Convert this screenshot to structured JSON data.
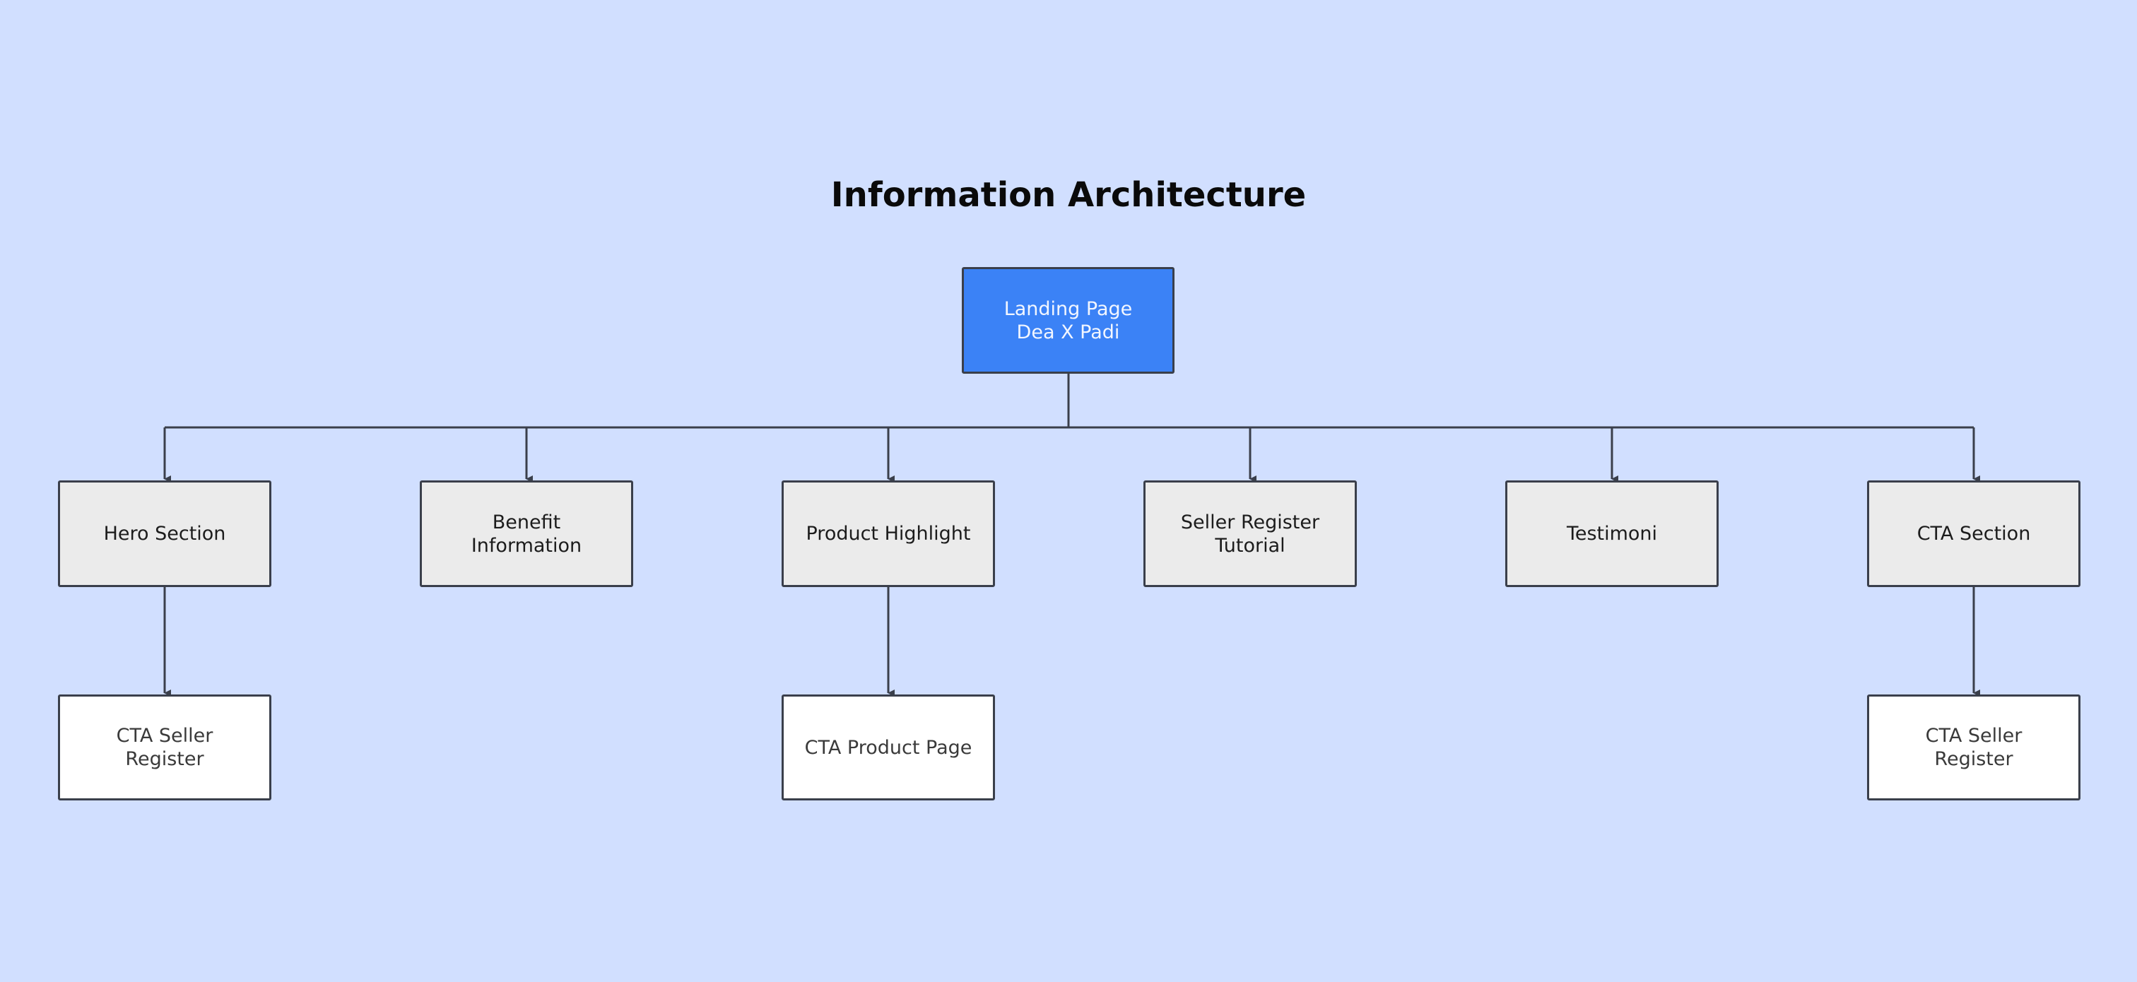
{
  "title": "Information Architecture",
  "colors": {
    "background": "#d1dfff",
    "root_fill": "#3b82f6",
    "section_fill": "#ebebeb",
    "child_fill": "#ffffff",
    "stroke": "#3a3f4b"
  },
  "root": {
    "label": "Landing Page\nDea X Padi"
  },
  "sections": [
    {
      "label": "Hero Section",
      "children": [
        {
          "label": "CTA Seller\nRegister"
        }
      ]
    },
    {
      "label": "Benefit\nInformation",
      "children": []
    },
    {
      "label": "Product Highlight",
      "children": [
        {
          "label": "CTA Product Page"
        }
      ]
    },
    {
      "label": "Seller Register\nTutorial",
      "children": []
    },
    {
      "label": "Testimoni",
      "children": []
    },
    {
      "label": "CTA Section",
      "children": [
        {
          "label": "CTA Seller\nRegister"
        }
      ]
    }
  ]
}
